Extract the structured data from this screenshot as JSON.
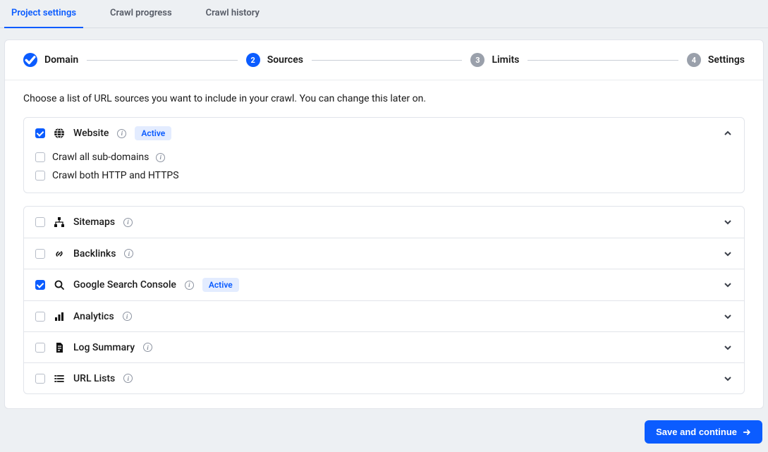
{
  "tabs": [
    {
      "label": "Project settings",
      "active": true
    },
    {
      "label": "Crawl progress",
      "active": false
    },
    {
      "label": "Crawl history",
      "active": false
    }
  ],
  "stepper": [
    {
      "num": "1",
      "label": "Domain",
      "state": "done"
    },
    {
      "num": "2",
      "label": "Sources",
      "state": "current"
    },
    {
      "num": "3",
      "label": "Limits",
      "state": "pending"
    },
    {
      "num": "4",
      "label": "Settings",
      "state": "pending"
    }
  ],
  "intro": "Choose a list of URL sources you want to include in your crawl. You can change this later on.",
  "active_badge": "Active",
  "sources": {
    "website": {
      "label": "Website",
      "checked": true,
      "expanded": true,
      "active": true
    },
    "sitemaps": {
      "label": "Sitemaps",
      "checked": false
    },
    "backlinks": {
      "label": "Backlinks",
      "checked": false
    },
    "gsc": {
      "label": "Google Search Console",
      "checked": true,
      "active": true
    },
    "analytics": {
      "label": "Analytics",
      "checked": false
    },
    "log_summary": {
      "label": "Log Summary",
      "checked": false
    },
    "url_lists": {
      "label": "URL Lists",
      "checked": false
    }
  },
  "website_options": {
    "crawl_subdomains": {
      "label": "Crawl all sub-domains",
      "checked": false
    },
    "crawl_http_https": {
      "label": "Crawl both HTTP and HTTPS",
      "checked": false
    }
  },
  "save_button": "Save and continue"
}
